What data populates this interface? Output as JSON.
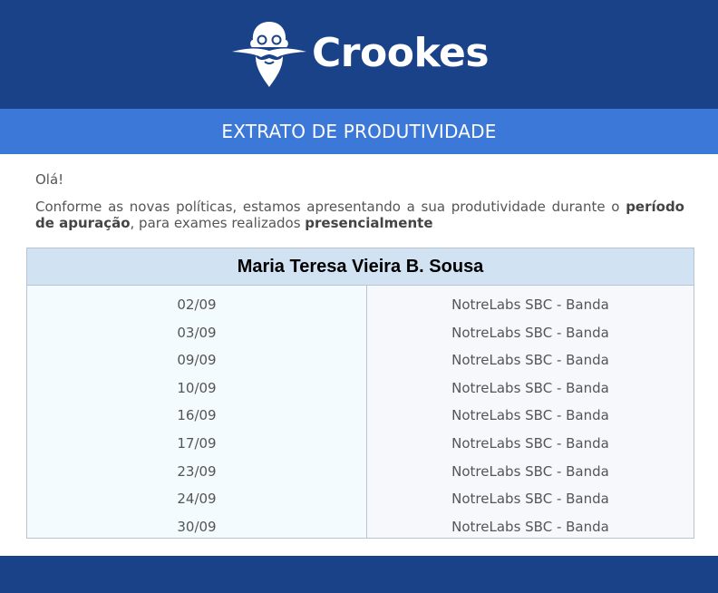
{
  "brand": {
    "name": "Crookes",
    "logo_icon": "bearded-scientist-icon"
  },
  "banner": {
    "title": "EXTRATO DE PRODUTIVIDADE"
  },
  "message": {
    "greeting": "Olá!",
    "intro_part1": "Conforme as novas políticas, estamos apresentando a sua produtividade durante o ",
    "intro_bold1": "período de apuração",
    "intro_part2": ", para exames realizados ",
    "intro_bold2": "presencialmente"
  },
  "report": {
    "name": "Maria Teresa Vieira B. Sousa",
    "rows": [
      {
        "date": "02/09",
        "location": "NotreLabs SBC - Banda"
      },
      {
        "date": "03/09",
        "location": "NotreLabs SBC - Banda"
      },
      {
        "date": "09/09",
        "location": "NotreLabs SBC - Banda"
      },
      {
        "date": "10/09",
        "location": "NotreLabs SBC - Banda"
      },
      {
        "date": "16/09",
        "location": "NotreLabs SBC - Banda"
      },
      {
        "date": "17/09",
        "location": "NotreLabs SBC - Banda"
      },
      {
        "date": "23/09",
        "location": "NotreLabs SBC - Banda"
      },
      {
        "date": "24/09",
        "location": "NotreLabs SBC - Banda"
      },
      {
        "date": "30/09",
        "location": "NotreLabs SBC - Banda"
      }
    ]
  },
  "colors": {
    "header_bg": "#1a4288",
    "banner_bg": "#3b78d8",
    "card_head_bg": "#d1e2f3"
  }
}
